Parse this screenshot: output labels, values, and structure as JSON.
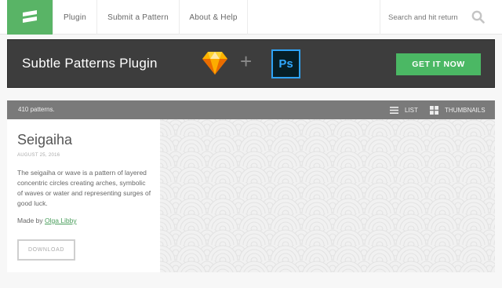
{
  "nav": {
    "items": [
      {
        "label": "Plugin"
      },
      {
        "label": "Submit a Pattern"
      },
      {
        "label": "About & Help"
      }
    ],
    "search_placeholder": "Search and hit return"
  },
  "banner": {
    "title": "Subtle Patterns Plugin",
    "ps_label": "Ps",
    "plus": "+",
    "cta_label": "GET IT NOW"
  },
  "toolbar": {
    "count": "410 patterns.",
    "list_label": "LIST",
    "thumbnails_label": "THUMBNAILS"
  },
  "pattern": {
    "title": "Seigaiha",
    "date": "AUGUST 25, 2016",
    "description": "The seigaiha or wave is a pattern of layered concentric circles creating arches, symbolic of waves or water and representing surges of good luck.",
    "made_by_label": "Made by",
    "author": "Olga Libby",
    "download_label": "DOWNLOAD"
  },
  "colors": {
    "brand_green": "#59b466",
    "cta_green": "#4bb864",
    "banner_bg": "#3d3d3d",
    "toolbar_bg": "#7a7a7a",
    "link_green": "#4a9e5c"
  },
  "icons": {
    "logo": "subtle-patterns-logo",
    "search": "search-icon",
    "sketch": "sketch-diamond-icon",
    "list": "list-icon",
    "grid": "grid-icon"
  }
}
